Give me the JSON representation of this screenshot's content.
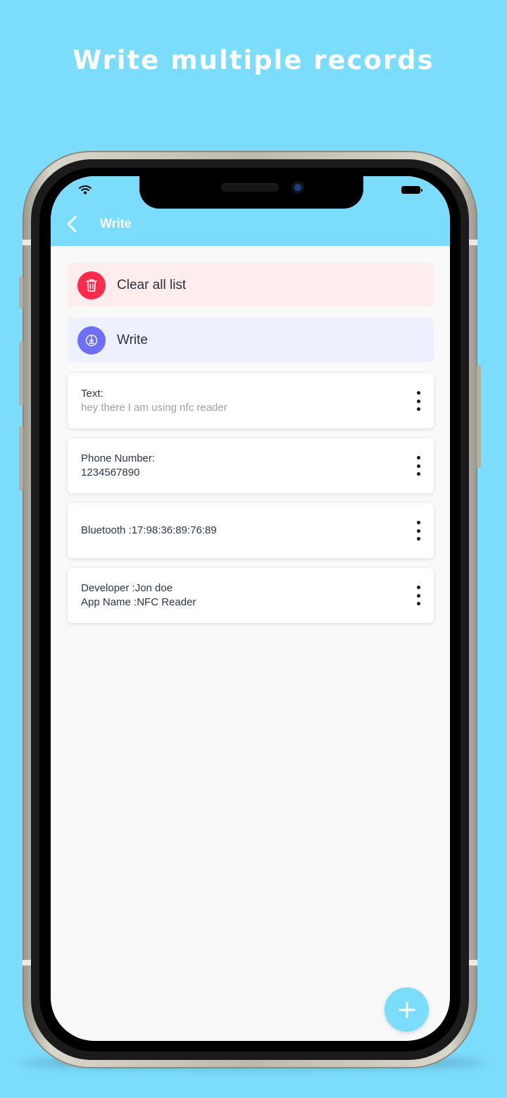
{
  "headline": "Write multiple records",
  "appbar": {
    "title": "Write",
    "color": "#7cdcfc"
  },
  "actions": {
    "clear_label": "Clear all list",
    "write_label": "Write"
  },
  "records": [
    {
      "line1": "Text:",
      "line2": "hey there I am using nfc reader"
    },
    {
      "line1": "Phone Number:",
      "line2": "1234567890"
    },
    {
      "line1": "Bluetooth :17:98:36:89:76:89"
    },
    {
      "line1": "Developer :Jon doe",
      "line2": "App Name :NFC Reader"
    }
  ],
  "icons": {
    "back": "chevron-left-icon",
    "clear": "trash-icon",
    "write": "nfc-write-icon",
    "menu": "more-vertical-icon",
    "add": "plus-icon",
    "wifi": "wifi-icon",
    "battery": "battery-icon"
  },
  "colors": {
    "background": "#7cdcfc",
    "clear_accent": "#ff2b4c",
    "clear_bg": "#fdeded",
    "write_accent": "#6d6ff8",
    "write_bg": "#edf0fd"
  }
}
